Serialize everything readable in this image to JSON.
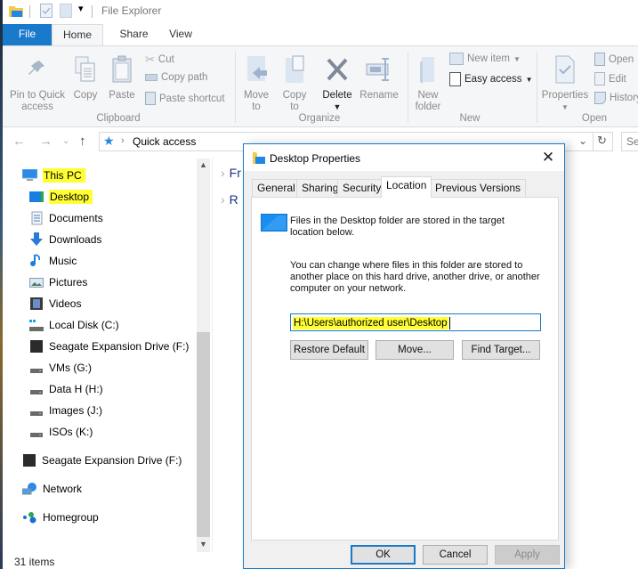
{
  "window": {
    "title": "File Explorer"
  },
  "ribbon_tabs": [
    "File",
    "Home",
    "Share",
    "View"
  ],
  "ribbon": {
    "clipboard": {
      "group_label": "Clipboard",
      "pin": "Pin to Quick access",
      "copy": "Copy",
      "paste": "Paste",
      "cut": "Cut",
      "copy_path": "Copy path",
      "paste_shortcut": "Paste shortcut"
    },
    "organize": {
      "group_label": "Organize",
      "move_to": "Move to",
      "copy_to": "Copy to",
      "delete": "Delete",
      "rename": "Rename"
    },
    "new": {
      "group_label": "New",
      "new_folder": "New folder",
      "new_item": "New item",
      "easy_access": "Easy access"
    },
    "open": {
      "group_label": "Open",
      "properties": "Properties",
      "open": "Open",
      "edit": "Edit",
      "history": "History"
    }
  },
  "nav": {
    "address": "Quick access",
    "search_placeholder": "Sea"
  },
  "sidebar": {
    "items": [
      {
        "label": "This PC",
        "icon": "computer-icon",
        "highlighted": true
      },
      {
        "label": "Desktop",
        "icon": "desktop-icon",
        "highlighted": true
      },
      {
        "label": "Documents",
        "icon": "documents-icon"
      },
      {
        "label": "Downloads",
        "icon": "downloads-icon"
      },
      {
        "label": "Music",
        "icon": "music-icon"
      },
      {
        "label": "Pictures",
        "icon": "pictures-icon"
      },
      {
        "label": "Videos",
        "icon": "videos-icon"
      },
      {
        "label": "Local Disk (C:)",
        "icon": "disk-icon"
      },
      {
        "label": "Seagate Expansion Drive (F:)",
        "icon": "external-drive-icon"
      },
      {
        "label": "VMs (G:)",
        "icon": "drive-icon"
      },
      {
        "label": "Data H (H:)",
        "icon": "drive-icon"
      },
      {
        "label": "Images (J:)",
        "icon": "drive-icon"
      },
      {
        "label": "ISOs (K:)",
        "icon": "drive-icon"
      },
      {
        "label": "Seagate Expansion Drive (F:)",
        "icon": "external-drive-icon"
      },
      {
        "label": "Network",
        "icon": "network-icon"
      },
      {
        "label": "Homegroup",
        "icon": "homegroup-icon"
      }
    ]
  },
  "content": {
    "rows": [
      "Fr",
      "R"
    ]
  },
  "status": {
    "items": "31 items"
  },
  "dialog": {
    "title": "Desktop Properties",
    "tabs": [
      "General",
      "Sharing",
      "Security",
      "Location",
      "Previous Versions"
    ],
    "active_tab": "Location",
    "intro": [
      "Files in the Desktop folder are stored in the target",
      "location below."
    ],
    "explain": [
      "You can change where files in this folder are stored to",
      "another place on this hard drive, another drive, or another",
      "computer on your network."
    ],
    "path_value": "H:\\Users\\authorized user\\Desktop",
    "buttons": {
      "restore_default": "Restore Default",
      "move": "Move...",
      "find_target": "Find Target...",
      "ok": "OK",
      "cancel": "Cancel",
      "apply": "Apply"
    }
  },
  "colors": {
    "accent": "#1979ca",
    "highlight": "#ffff33"
  }
}
